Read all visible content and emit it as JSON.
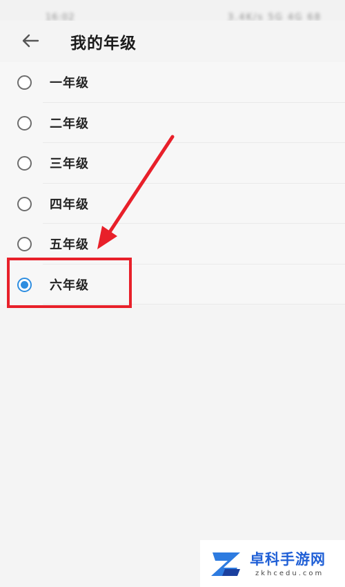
{
  "status_bar": {
    "time": "16:02",
    "indicators": "3.4K/s 5G 4G 68"
  },
  "header": {
    "back_icon": "arrow-left-icon",
    "title": "我的年级"
  },
  "grades": [
    {
      "label": "一年级",
      "selected": false
    },
    {
      "label": "二年级",
      "selected": false
    },
    {
      "label": "三年级",
      "selected": false
    },
    {
      "label": "四年级",
      "selected": false
    },
    {
      "label": "五年级",
      "selected": false
    },
    {
      "label": "六年级",
      "selected": true
    }
  ],
  "colors": {
    "accent": "#2d8de0",
    "annotation": "#e8202a",
    "watermark_blue": "#1f5fd6"
  },
  "watermark": {
    "title": "卓科手游网",
    "subtitle": "zkhcedu.com"
  }
}
